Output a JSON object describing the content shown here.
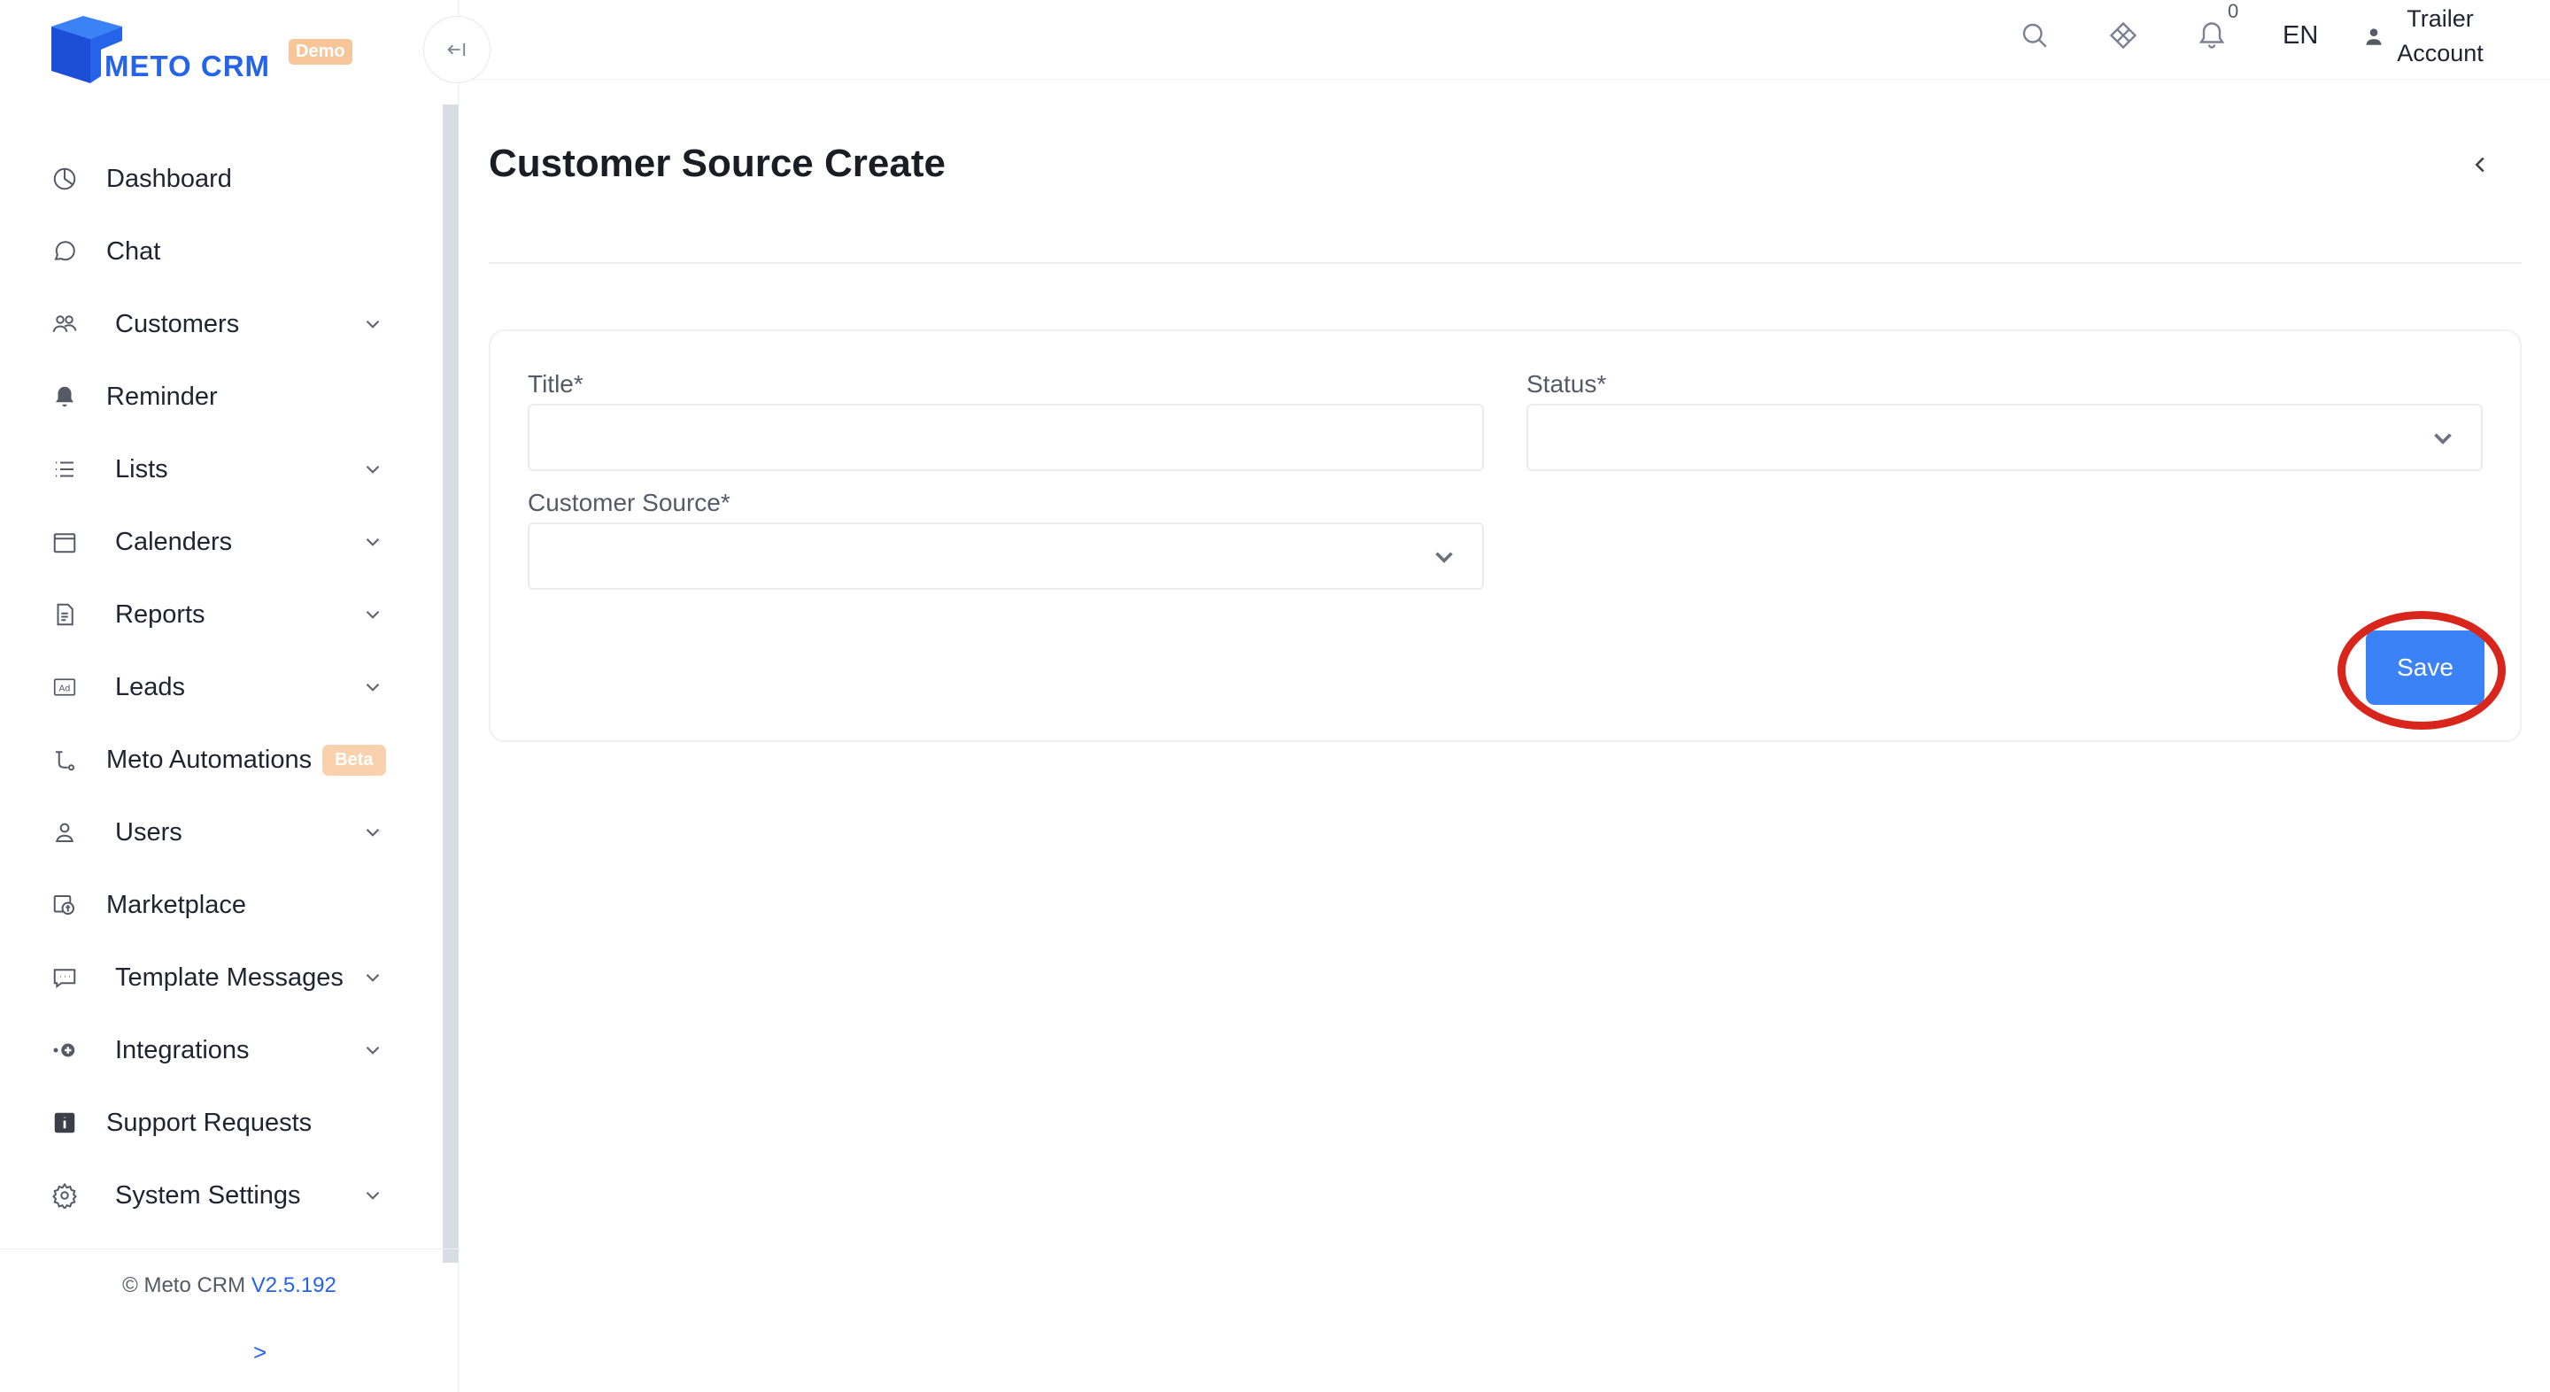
{
  "brand": {
    "name": "METO CRM",
    "badge": "Demo",
    "primary_color": "#2563eb"
  },
  "sidebar": {
    "items": [
      {
        "label": "Dashboard",
        "icon": "pie-chart-icon",
        "expandable": false
      },
      {
        "label": "Chat",
        "icon": "chat-bubble-icon",
        "expandable": false
      },
      {
        "label": "Customers",
        "icon": "users-icon",
        "expandable": true
      },
      {
        "label": "Reminder",
        "icon": "bell-icon",
        "expandable": false
      },
      {
        "label": "Lists",
        "icon": "list-icon",
        "expandable": true
      },
      {
        "label": "Calenders",
        "icon": "calendar-icon",
        "expandable": true
      },
      {
        "label": "Reports",
        "icon": "document-icon",
        "expandable": true
      },
      {
        "label": "Leads",
        "icon": "ad-icon",
        "expandable": true
      },
      {
        "label": "Meto Automations",
        "icon": "flow-icon",
        "expandable": false,
        "badge": "Beta"
      },
      {
        "label": "Users",
        "icon": "user-icon",
        "expandable": true
      },
      {
        "label": "Marketplace",
        "icon": "store-icon",
        "expandable": false
      },
      {
        "label": "Template Messages",
        "icon": "message-icon",
        "expandable": true
      },
      {
        "label": "Integrations",
        "icon": "plug-icon",
        "expandable": true
      },
      {
        "label": "Support Requests",
        "icon": "info-icon",
        "expandable": false
      },
      {
        "label": "System Settings",
        "icon": "gear-icon",
        "expandable": true
      }
    ],
    "footer": {
      "copyright": "© Meto CRM",
      "version": "V2.5.192",
      "expand": ">"
    }
  },
  "header": {
    "notification_count": "0",
    "language": "EN",
    "user_line1": "Trailer",
    "user_line2": "Account"
  },
  "page": {
    "title": "Customer Source Create",
    "form": {
      "title_label": "Title*",
      "title_value": "",
      "status_label": "Status*",
      "status_value": "",
      "source_label": "Customer Source*",
      "source_value": "",
      "save_label": "Save"
    }
  }
}
